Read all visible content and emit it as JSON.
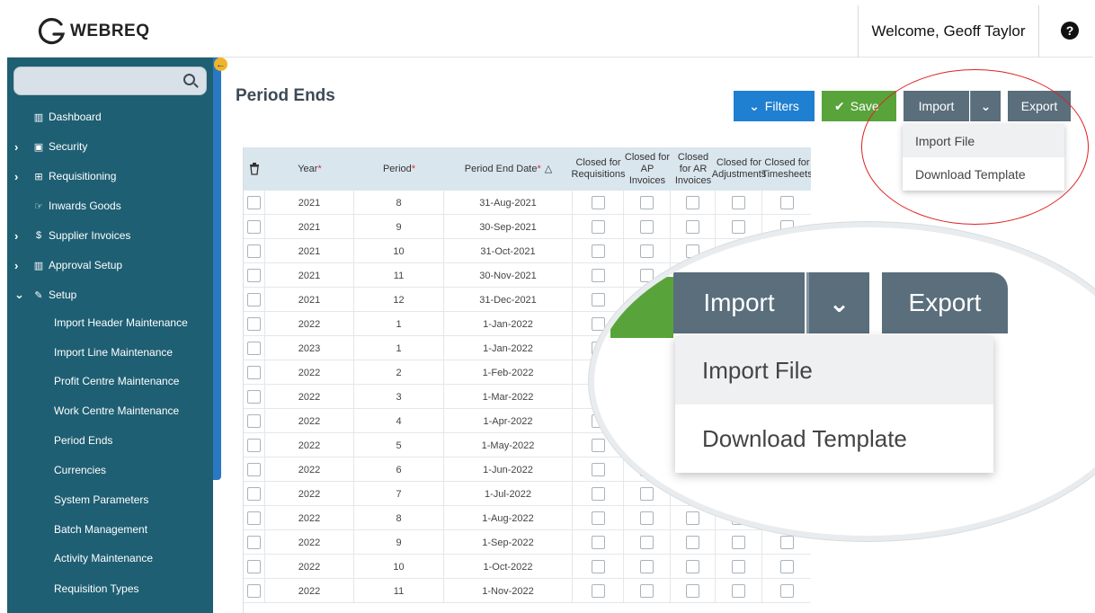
{
  "app": {
    "logo_text": "WEBREQ",
    "welcome": "Welcome, Geoff Taylor",
    "help_icon": "question-circle-icon"
  },
  "sidebar": {
    "search_icon": "search-icon",
    "items": [
      {
        "label": "Dashboard",
        "icon": "bar-chart-icon",
        "has_chevron": false
      },
      {
        "label": "Security",
        "icon": "lock-icon",
        "has_chevron": true
      },
      {
        "label": "Requisitioning",
        "icon": "cart-icon",
        "has_chevron": true
      },
      {
        "label": "Inwards Goods",
        "icon": "hand-pointer-icon",
        "has_chevron": false
      },
      {
        "label": "Supplier Invoices",
        "icon": "dollar-icon",
        "has_chevron": true
      },
      {
        "label": "Approval Setup",
        "icon": "bar-chart-icon",
        "has_chevron": true
      },
      {
        "label": "Setup",
        "icon": "wrench-icon",
        "has_chevron": true,
        "expanded": true
      }
    ],
    "setup_children": [
      "Import Header Maintenance",
      "Import Line Maintenance",
      "Profit Centre Maintenance",
      "Work Centre Maintenance",
      "Period Ends",
      "Currencies",
      "System Parameters",
      "Batch Management",
      "Activity Maintenance",
      "Requisition Types"
    ]
  },
  "main": {
    "title": "Period Ends",
    "buttons": {
      "filters": "Filters",
      "save": "Save",
      "import": "Import",
      "export": "Export"
    },
    "import_menu": [
      "Import File",
      "Download Template"
    ]
  },
  "table": {
    "headers": {
      "year": "Year",
      "period": "Period",
      "period_end_date": "Period End Date",
      "closed_requisitions": "Closed for Requisitions",
      "closed_ap": "Closed for AP Invoices",
      "closed_ar": "Closed for AR Invoices",
      "closed_adjustments": "Closed for Adjustments",
      "closed_timesheets": "Closed for Timesheets"
    },
    "required_mark": "*",
    "sort_icon": "sort-ascending-icon",
    "rows": [
      [
        "2021",
        "8",
        "31-Aug-2021"
      ],
      [
        "2021",
        "9",
        "30-Sep-2021"
      ],
      [
        "2021",
        "10",
        "31-Oct-2021"
      ],
      [
        "2021",
        "11",
        "30-Nov-2021"
      ],
      [
        "2021",
        "12",
        "31-Dec-2021"
      ],
      [
        "2022",
        "1",
        "1-Jan-2022"
      ],
      [
        "2023",
        "1",
        "1-Jan-2022"
      ],
      [
        "2022",
        "2",
        "1-Feb-2022"
      ],
      [
        "2022",
        "3",
        "1-Mar-2022"
      ],
      [
        "2022",
        "4",
        "1-Apr-2022"
      ],
      [
        "2022",
        "5",
        "1-May-2022"
      ],
      [
        "2022",
        "6",
        "1-Jun-2022"
      ],
      [
        "2022",
        "7",
        "1-Jul-2022"
      ],
      [
        "2022",
        "8",
        "1-Aug-2022"
      ],
      [
        "2022",
        "9",
        "1-Sep-2022"
      ],
      [
        "2022",
        "10",
        "1-Oct-2022"
      ],
      [
        "2022",
        "11",
        "1-Nov-2022"
      ]
    ]
  },
  "magnifier": {
    "import": "Import",
    "export": "Export",
    "menu": [
      "Import File",
      "Download Template"
    ]
  },
  "colors": {
    "sidebar": "#1e5f73",
    "primary": "#1f7fd0",
    "save": "#58a43a",
    "neutral": "#5a6e7c",
    "annotation": "#dd2222"
  }
}
